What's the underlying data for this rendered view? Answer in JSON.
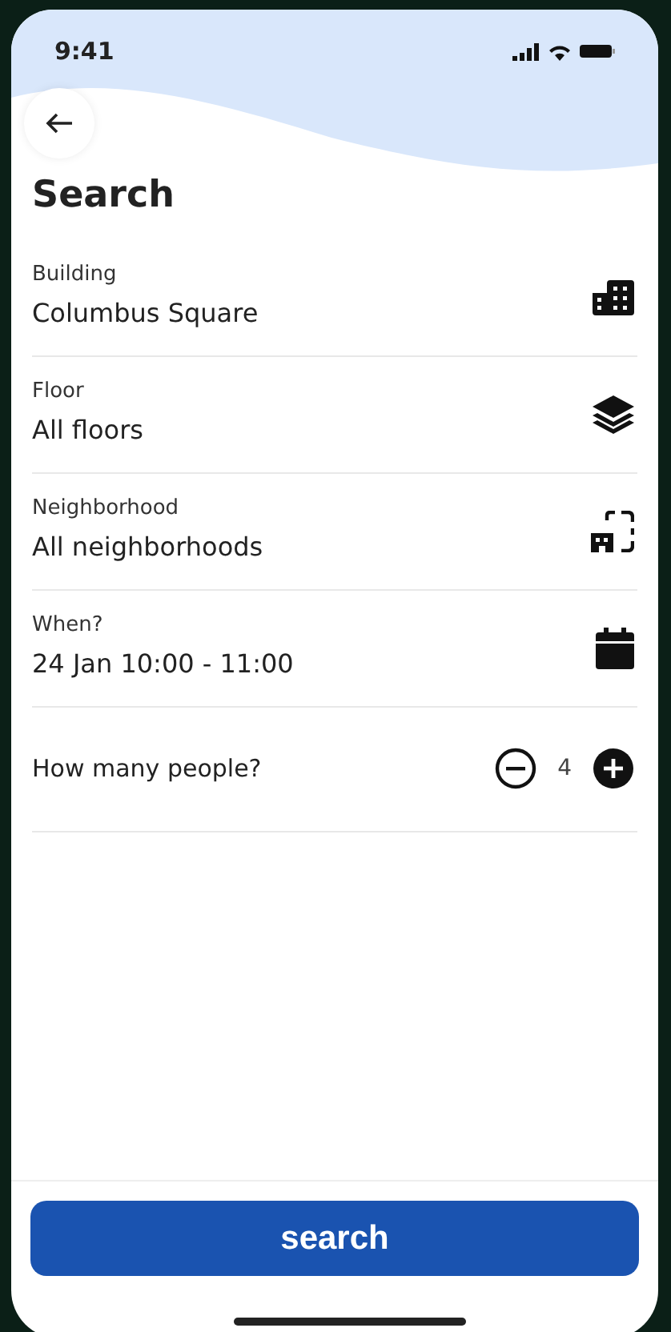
{
  "status_bar": {
    "time": "9:41"
  },
  "title": "Search",
  "fields": [
    {
      "kind": "select",
      "label": "Building",
      "value": "Columbus Square"
    },
    {
      "kind": "select",
      "label": "Floor",
      "value": "All floors"
    },
    {
      "kind": "select",
      "label": "Neighborhood",
      "value": "All neighborhoods"
    },
    {
      "kind": "select",
      "label": "When?",
      "value": "24 Jan 10:00 - 11:00"
    },
    {
      "kind": "counter",
      "label": "How many people?",
      "value": "4"
    }
  ],
  "search_button": "search"
}
